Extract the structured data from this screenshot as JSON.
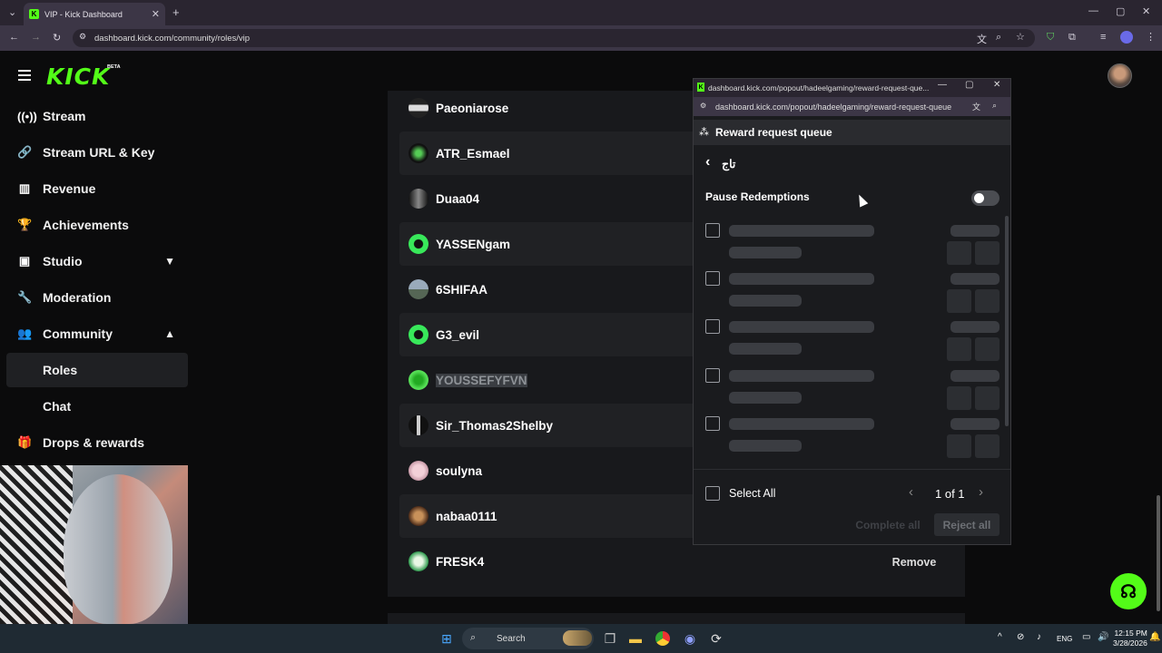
{
  "browser": {
    "tab_title": "VIP - Kick Dashboard",
    "url": "dashboard.kick.com/community/roles/vip"
  },
  "sidebar": {
    "logo": "KICK",
    "beta": "BETA",
    "items": [
      {
        "label": "Stream",
        "icon": "broadcast-icon"
      },
      {
        "label": "Stream URL & Key",
        "icon": "link-icon"
      },
      {
        "label": "Revenue",
        "icon": "chart-icon"
      },
      {
        "label": "Achievements",
        "icon": "trophy-icon"
      },
      {
        "label": "Studio",
        "icon": "studio-icon"
      },
      {
        "label": "Moderation",
        "icon": "wrench-icon"
      },
      {
        "label": "Community",
        "icon": "community-icon"
      },
      {
        "label": "Roles"
      },
      {
        "label": "Chat"
      },
      {
        "label": "Drops & rewards",
        "icon": "gift-icon"
      }
    ]
  },
  "vip_list": {
    "users": [
      "Paeoniarose",
      "ATR_Esmael",
      "Duaa04",
      "YASSENgam",
      "6SHIFAA",
      "G3_evil",
      "YOUSSEFYFVN",
      "Sir_Thomas2Shelby",
      "soulyna",
      "nabaa0111",
      "FRESK4"
    ],
    "remove_label": "Remove"
  },
  "popup": {
    "title_url": "dashboard.kick.com/popout/hadeelgaming/reward-request-que...",
    "url": "dashboard.kick.com/popout/hadeelgaming/reward-request-queue",
    "header": "Reward request queue",
    "reward_name": "تاج",
    "pause_label": "Pause Redemptions",
    "pause_on": false,
    "select_all": "Select All",
    "pager": "1 of 1",
    "complete_all": "Complete all",
    "reject_all": "Reject all"
  },
  "taskbar": {
    "search": "Search",
    "lang": "ENG",
    "time": "12:15 PM",
    "date": "3/28/2026"
  }
}
